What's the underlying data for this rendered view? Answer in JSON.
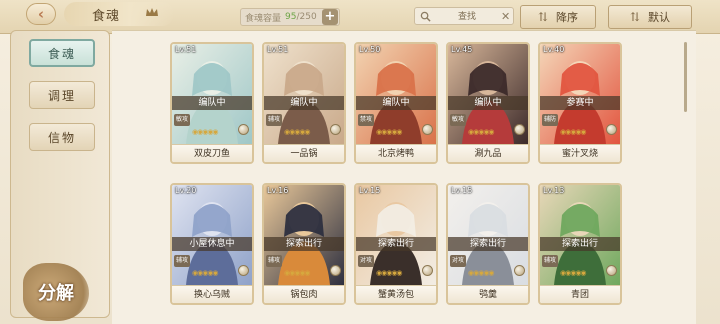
{
  "header": {
    "title": "食魂",
    "capacity_label": "食魂容量",
    "capacity_used": "95",
    "capacity_total": "250",
    "search_placeholder": "查找",
    "sort_desc_label": "降序",
    "sort_default_label": "默认"
  },
  "sidebar": {
    "tabs": [
      {
        "label": "食魂",
        "active": true
      },
      {
        "label": "调理",
        "active": false
      },
      {
        "label": "信物",
        "active": false
      }
    ],
    "decompose_label": "分解"
  },
  "cards": [
    {
      "level": "Lv.51",
      "status": "编队中",
      "badge": "敏攻",
      "name": "双皮刀鱼",
      "palette": [
        "#9fc7c7",
        "#e9efe6",
        "#b4d3cc"
      ]
    },
    {
      "level": "Lv.51",
      "status": "编队中",
      "badge": "辅攻",
      "name": "一品锅",
      "palette": [
        "#c9a98a",
        "#efe1cc",
        "#7b5c4a"
      ]
    },
    {
      "level": "Lv.50",
      "status": "编队中",
      "badge": "禁攻",
      "name": "北京烤鸭",
      "palette": [
        "#d9724a",
        "#f2d3b1",
        "#8f3d2b"
      ]
    },
    {
      "level": "Lv.45",
      "status": "编队中",
      "badge": "敏攻",
      "name": "涮九品",
      "palette": [
        "#3c2a2a",
        "#d8b79a",
        "#b53b3b"
      ]
    },
    {
      "level": "Lv.40",
      "status": "参赛中",
      "badge": "辅防",
      "name": "蜜汁叉烧",
      "palette": [
        "#e2553f",
        "#f4d6b8",
        "#c43b2e"
      ]
    },
    {
      "level": "Lv.20",
      "status": "小屋休息中",
      "badge": "辅攻",
      "name": "换心乌贼",
      "palette": [
        "#8fa2c9",
        "#dfe3f0",
        "#5d6d9a"
      ]
    },
    {
      "level": "Lv.16",
      "status": "探索出行",
      "badge": "辅攻",
      "name": "锅包肉",
      "palette": [
        "#2d2f3f",
        "#e9c89a",
        "#d98a3a"
      ]
    },
    {
      "level": "Lv.15",
      "status": "探索出行",
      "badge": "对攻",
      "name": "蟹黄汤包",
      "palette": [
        "#f2ede4",
        "#e9c8a2",
        "#3a2f2a"
      ]
    },
    {
      "level": "Lv.15",
      "status": "探索出行",
      "badge": "对攻",
      "name": "鸮羹",
      "palette": [
        "#d9dde2",
        "#f3f0ec",
        "#8a8f99"
      ]
    },
    {
      "level": "Lv.13",
      "status": "探索出行",
      "badge": "辅攻",
      "name": "青团",
      "palette": [
        "#6fa85e",
        "#e8d7b8",
        "#3e6e3a"
      ]
    }
  ]
}
